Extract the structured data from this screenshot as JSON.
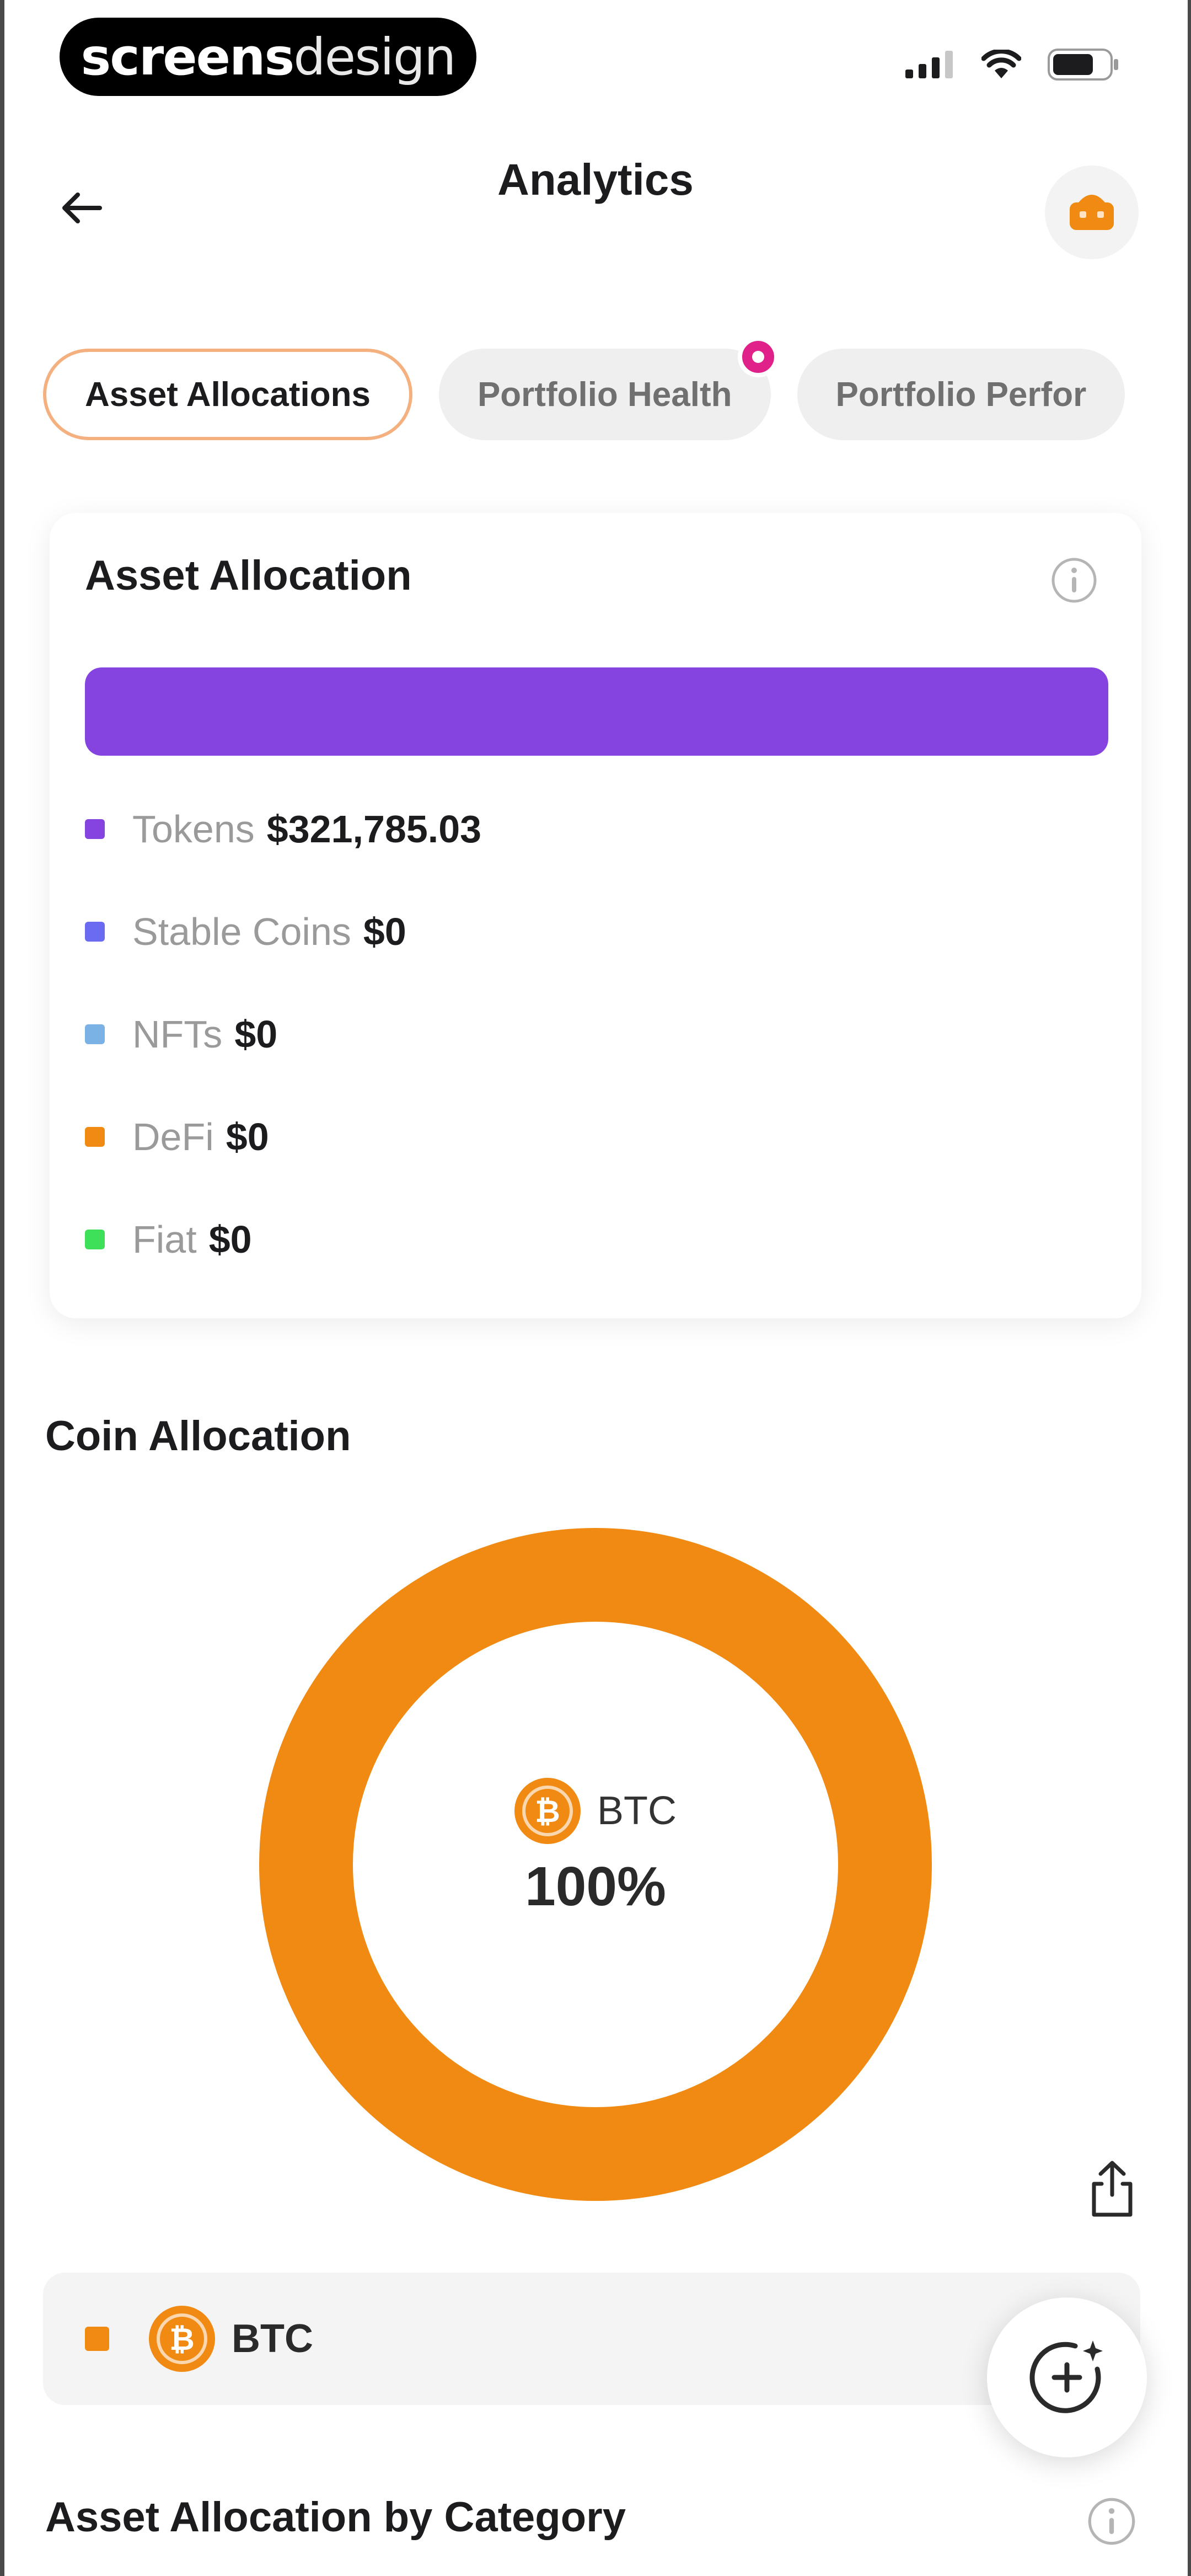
{
  "status_bar": {
    "brand_bold": "screens",
    "brand_light": "design",
    "icons": [
      "cellular-signal-icon",
      "wifi-icon",
      "battery-icon"
    ]
  },
  "header": {
    "title": "Analytics",
    "back_icon": "arrow-left-icon",
    "avatar_icon": "avatar-icon"
  },
  "tabs": [
    {
      "label": "Asset Allocations",
      "active": true
    },
    {
      "label": "Portfolio Health",
      "active": false,
      "badge": true
    },
    {
      "label": "Portfolio Perfor",
      "active": false
    }
  ],
  "asset_allocation": {
    "title": "Asset Allocation",
    "bar_color": "#8543e0",
    "bar_fraction": 1.0,
    "legend": [
      {
        "label": "Tokens",
        "value": "$321,785.03",
        "color": "#8543e0"
      },
      {
        "label": "Stable Coins",
        "value": "$0",
        "color": "#6b6bf2"
      },
      {
        "label": "NFTs",
        "value": "$0",
        "color": "#7ab2e6"
      },
      {
        "label": "DeFi",
        "value": "$0",
        "color": "#f08a12"
      },
      {
        "label": "Fiat",
        "value": "$0",
        "color": "#3ee05a"
      }
    ]
  },
  "coin_allocation": {
    "title": "Coin Allocation",
    "center_coin": "BTC",
    "center_percent": "100%",
    "donut_color": "#f08a12",
    "share_icon": "share-icon"
  },
  "chart_data": {
    "type": "pie",
    "categories": [
      "BTC"
    ],
    "values": [
      100
    ]
  },
  "coin_list": [
    {
      "label": "BTC",
      "color": "#f08a12"
    }
  ],
  "category_section": {
    "title": "Asset Allocation by Category"
  },
  "fab_icon": "ai-assistant-icon"
}
